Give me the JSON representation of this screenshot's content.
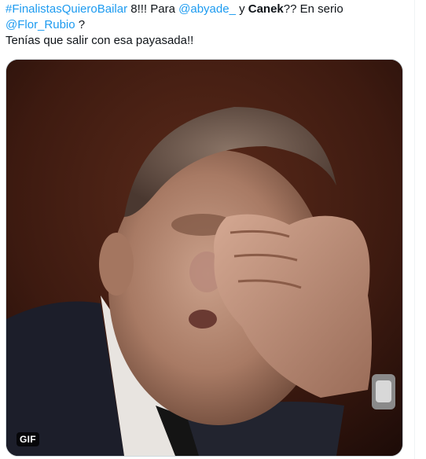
{
  "tweet": {
    "hashtag": "#FinalistasQuieroBailar",
    "text_1": " 8!!! Para ",
    "mention_1": "@abyade_",
    "text_2": "  y ",
    "bold_name": "Canek",
    "text_3": "?? En serio",
    "mention_2": "@Flor_Rubio",
    "text_4": " ?",
    "line_3": "Tenías que salir con esa payasada!!"
  },
  "media": {
    "badge": "GIF",
    "icon": "gif-badge-icon"
  },
  "colors": {
    "link": "#1d9bf0",
    "text": "#0f1419",
    "background": "#ffffff",
    "media_bg": "#3a1a12"
  }
}
